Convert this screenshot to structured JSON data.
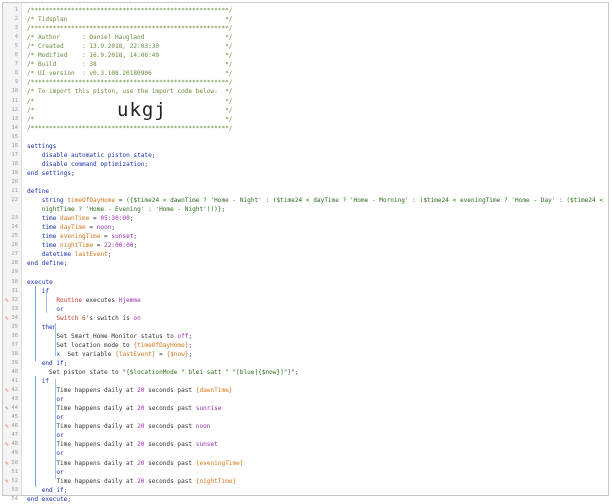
{
  "lines": [
    {
      "n": "1",
      "parts": [
        [
          "cm",
          "/******************************************************/"
        ]
      ]
    },
    {
      "n": "2",
      "parts": [
        [
          "cm",
          "/* Tidsplan                                           */"
        ]
      ]
    },
    {
      "n": "3",
      "parts": [
        [
          "cm",
          "/******************************************************/"
        ]
      ]
    },
    {
      "n": "4",
      "parts": [
        [
          "cm",
          "/* Author      : Daniel Haugland                      */"
        ]
      ]
    },
    {
      "n": "5",
      "parts": [
        [
          "cm",
          "/* Created     : 13.9.2018, 22:03:30                  */"
        ]
      ]
    },
    {
      "n": "6",
      "parts": [
        [
          "cm",
          "/* Modified    : 16.9.2018, 14:06:49                  */"
        ]
      ]
    },
    {
      "n": "7",
      "parts": [
        [
          "cm",
          "/* Build       : 38                                   */"
        ]
      ]
    },
    {
      "n": "8",
      "parts": [
        [
          "cm",
          "/* UI version  : v0.3.108.20180906                    */"
        ]
      ]
    },
    {
      "n": "9",
      "parts": [
        [
          "cm",
          "/******************************************************/"
        ]
      ]
    },
    {
      "n": "10",
      "parts": [
        [
          "cm",
          "/* To import this piston, use the import code below:  */"
        ]
      ]
    },
    {
      "n": "11",
      "parts": [
        [
          "cm",
          "/*                                                    */"
        ]
      ]
    },
    {
      "n": "12",
      "parts": [
        [
          "cm",
          "/*                                                    */"
        ]
      ]
    },
    {
      "n": "13",
      "parts": [
        [
          "cm",
          "/*                                                    */"
        ]
      ]
    },
    {
      "n": "14",
      "parts": [
        [
          "cm",
          "/******************************************************/"
        ]
      ]
    },
    {
      "n": "15",
      "parts": []
    },
    {
      "n": "16",
      "parts": [
        [
          "kw",
          "settings"
        ]
      ]
    },
    {
      "n": "17",
      "parts": [
        [
          "plain",
          "    "
        ],
        [
          "kw",
          "disable automatic piston state"
        ],
        [
          "plain",
          ";"
        ]
      ]
    },
    {
      "n": "18",
      "parts": [
        [
          "plain",
          "    "
        ],
        [
          "kw",
          "disable command optimization"
        ],
        [
          "plain",
          ";"
        ]
      ]
    },
    {
      "n": "19",
      "parts": [
        [
          "kw",
          "end settings"
        ],
        [
          "plain",
          ";"
        ]
      ]
    },
    {
      "n": "20",
      "parts": []
    },
    {
      "n": "21",
      "parts": [
        [
          "kw",
          "define"
        ]
      ]
    },
    {
      "n": "22",
      "parts": [
        [
          "plain",
          "    "
        ],
        [
          "kw",
          "string "
        ],
        [
          "var",
          "timeOfDayHome"
        ],
        [
          "plain",
          " = "
        ],
        [
          "str",
          "({$time24 < dawnTime ? 'Home - Night' : ($time24 < dayTime ? 'Home - Morning' : ($time24 < eveningTime ? 'Home - Day' : ($time24 <"
        ]
      ]
    },
    {
      "n": "",
      "parts": [
        [
          "plain",
          "    "
        ],
        [
          "str",
          "nightTime ? 'Home - Evening' : 'Home - Night')))}"
        ],
        [
          "plain",
          ";"
        ]
      ]
    },
    {
      "n": "23",
      "parts": [
        [
          "plain",
          "    "
        ],
        [
          "kw",
          "time "
        ],
        [
          "var",
          "dawnTime"
        ],
        [
          "plain",
          " = "
        ],
        [
          "num",
          "05:30:00"
        ],
        [
          "plain",
          ";"
        ]
      ]
    },
    {
      "n": "24",
      "parts": [
        [
          "plain",
          "    "
        ],
        [
          "kw",
          "time "
        ],
        [
          "var",
          "dayTime"
        ],
        [
          "plain",
          " = "
        ],
        [
          "num",
          "noon"
        ],
        [
          "plain",
          ";"
        ]
      ]
    },
    {
      "n": "25",
      "parts": [
        [
          "plain",
          "    "
        ],
        [
          "kw",
          "time "
        ],
        [
          "var",
          "eveningTime"
        ],
        [
          "plain",
          " = "
        ],
        [
          "num",
          "sunset"
        ],
        [
          "plain",
          ";"
        ]
      ]
    },
    {
      "n": "26",
      "parts": [
        [
          "plain",
          "    "
        ],
        [
          "kw",
          "time "
        ],
        [
          "var",
          "nightTime"
        ],
        [
          "plain",
          " = "
        ],
        [
          "num",
          "22:00:00"
        ],
        [
          "plain",
          ";"
        ]
      ]
    },
    {
      "n": "27",
      "parts": [
        [
          "plain",
          "    "
        ],
        [
          "kw",
          "datetime "
        ],
        [
          "var",
          "lastEvent"
        ],
        [
          "plain",
          ";"
        ]
      ]
    },
    {
      "n": "28",
      "parts": [
        [
          "kw",
          "end define"
        ],
        [
          "plain",
          ";"
        ]
      ]
    },
    {
      "n": "29",
      "parts": []
    },
    {
      "n": "30",
      "parts": [
        [
          "kw",
          "execute"
        ]
      ]
    },
    {
      "n": "31",
      "parts": [
        [
          "plain",
          "    "
        ],
        [
          "kw",
          "if"
        ]
      ]
    },
    {
      "n": "32",
      "pen": true,
      "parts": [
        [
          "plain",
          "        "
        ],
        [
          "fn",
          "Routine"
        ],
        [
          "plain",
          " executes "
        ],
        [
          "num",
          "Hjemme"
        ]
      ]
    },
    {
      "n": "33",
      "parts": [
        [
          "plain",
          "        "
        ],
        [
          "kw",
          "or"
        ]
      ]
    },
    {
      "n": "34",
      "pen": true,
      "parts": [
        [
          "plain",
          "        "
        ],
        [
          "fn",
          "Switch 6"
        ],
        [
          "plain",
          "'s switch is "
        ],
        [
          "num",
          "on"
        ]
      ]
    },
    {
      "n": "35",
      "parts": [
        [
          "plain",
          "    "
        ],
        [
          "kw",
          "then"
        ]
      ]
    },
    {
      "n": "36",
      "parts": [
        [
          "plain",
          "        Set Smart Home Monitor status to "
        ],
        [
          "num",
          "off"
        ],
        [
          "plain",
          ";"
        ]
      ]
    },
    {
      "n": "37",
      "parts": [
        [
          "plain",
          "        Set location mode to "
        ],
        [
          "var",
          "{timeOfDayHome}"
        ],
        [
          "plain",
          ";"
        ]
      ]
    },
    {
      "n": "38",
      "parts": [
        [
          "plain",
          "        "
        ],
        [
          "kw",
          "x"
        ],
        [
          "plain",
          "  Set variable "
        ],
        [
          "var",
          "{lastEvent}"
        ],
        [
          "plain",
          " = "
        ],
        [
          "var",
          "{$now}"
        ],
        [
          "plain",
          ";"
        ]
      ]
    },
    {
      "n": "39",
      "parts": [
        [
          "plain",
          "    "
        ],
        [
          "kw",
          "end if"
        ],
        [
          "plain",
          ";"
        ]
      ]
    },
    {
      "n": "40",
      "parts": [
        [
          "plain",
          "      Set piston state to \""
        ],
        [
          "str",
          "{$locationMode \" blei satt \" \"[blue|{$now}]\"}"
        ],
        [
          "plain",
          "\";"
        ]
      ]
    },
    {
      "n": "41",
      "parts": [
        [
          "plain",
          "    "
        ],
        [
          "kw",
          "if"
        ]
      ]
    },
    {
      "n": "42",
      "pen": true,
      "parts": [
        [
          "plain",
          "        Time happens daily at "
        ],
        [
          "num",
          "20"
        ],
        [
          "plain",
          " seconds past "
        ],
        [
          "var",
          "{dawnTime}"
        ]
      ]
    },
    {
      "n": "43",
      "parts": [
        [
          "plain",
          "        "
        ],
        [
          "kw",
          "or"
        ]
      ]
    },
    {
      "n": "44",
      "pen": true,
      "parts": [
        [
          "plain",
          "        Time happens daily at "
        ],
        [
          "num",
          "20"
        ],
        [
          "plain",
          " seconds past "
        ],
        [
          "num",
          "sunrise"
        ]
      ]
    },
    {
      "n": "45",
      "parts": [
        [
          "plain",
          "        "
        ],
        [
          "kw",
          "or"
        ]
      ]
    },
    {
      "n": "46",
      "pen": true,
      "parts": [
        [
          "plain",
          "        Time happens daily at "
        ],
        [
          "num",
          "20"
        ],
        [
          "plain",
          " seconds past "
        ],
        [
          "num",
          "noon"
        ]
      ]
    },
    {
      "n": "47",
      "parts": [
        [
          "plain",
          "        "
        ],
        [
          "kw",
          "or"
        ]
      ]
    },
    {
      "n": "48",
      "pen": true,
      "parts": [
        [
          "plain",
          "        Time happens daily at "
        ],
        [
          "num",
          "20"
        ],
        [
          "plain",
          " seconds past "
        ],
        [
          "num",
          "sunset"
        ]
      ]
    },
    {
      "n": "49",
      "parts": [
        [
          "plain",
          "        "
        ],
        [
          "kw",
          "or"
        ]
      ]
    },
    {
      "n": "50",
      "pen": true,
      "parts": [
        [
          "plain",
          "        Time happens daily at "
        ],
        [
          "num",
          "20"
        ],
        [
          "plain",
          " seconds past "
        ],
        [
          "var",
          "{eveningTime}"
        ]
      ]
    },
    {
      "n": "51",
      "parts": [
        [
          "plain",
          "        "
        ],
        [
          "kw",
          "or"
        ]
      ]
    },
    {
      "n": "52",
      "pen": true,
      "parts": [
        [
          "plain",
          "        Time happens daily at "
        ],
        [
          "num",
          "20"
        ],
        [
          "plain",
          " seconds past "
        ],
        [
          "var",
          "{nightTime}"
        ]
      ]
    },
    {
      "n": "53",
      "parts": [
        [
          "plain",
          "    "
        ],
        [
          "kw",
          "end if"
        ],
        [
          "plain",
          ";"
        ]
      ]
    },
    {
      "n": "54",
      "parts": [
        [
          "kw",
          "end execute"
        ],
        [
          "plain",
          ";"
        ]
      ]
    }
  ],
  "import_code": "ukgj",
  "pen_icon": "edit-pencil-icon",
  "colors": {
    "comment": "#6a8a3a",
    "keyword": "#1c2ea8",
    "device": "#c0392b",
    "value": "#9b2fae",
    "string": "#2e6b1e",
    "variable": "#d4761a",
    "edit": "#e0662a"
  }
}
